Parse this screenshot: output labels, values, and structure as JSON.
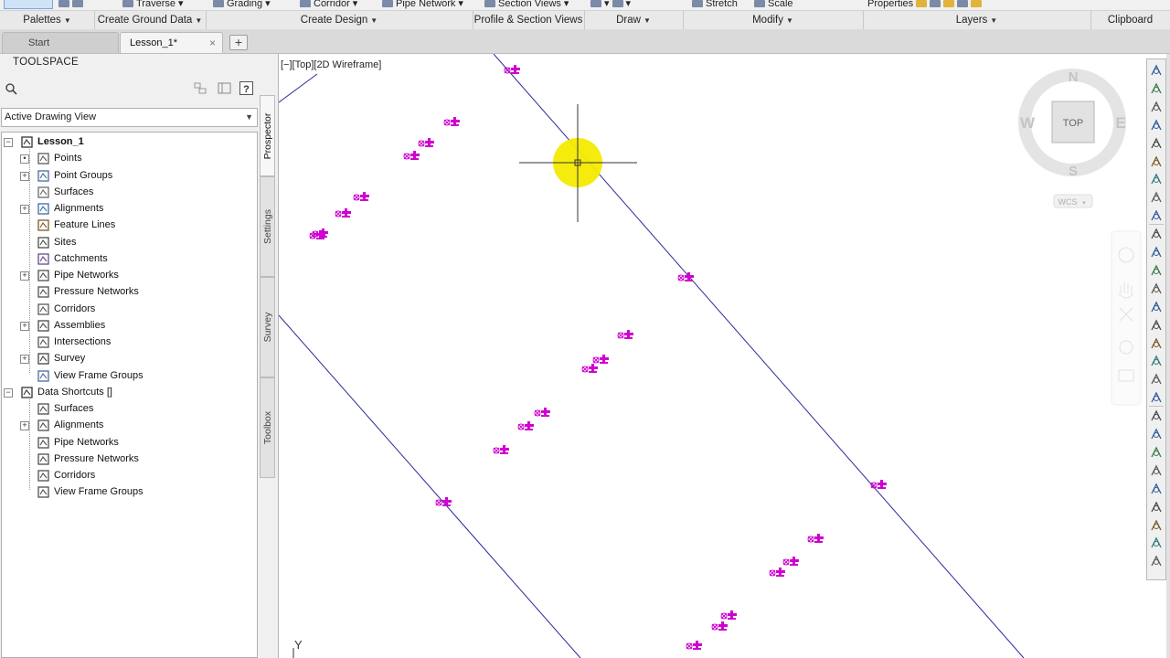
{
  "ribbon": {
    "top_tools": [
      "Traverse",
      "Grading",
      "Corridor",
      "Pipe Network",
      "Section Views",
      "Stretch",
      "Scale",
      "Properties"
    ],
    "panels": [
      "Palettes",
      "Create Ground Data",
      "Create Design",
      "Profile & Section Views",
      "Draw",
      "Modify",
      "Layers",
      "Clipboard"
    ]
  },
  "tabs": [
    {
      "label": "Start"
    },
    {
      "label": "Lesson_1*",
      "close": "×"
    }
  ],
  "new_tab_symbol": "+",
  "toolspace": {
    "title": "TOOLSPACE",
    "dropdown_value": "Active Drawing View",
    "side_tabs": [
      "Prospector",
      "Settings",
      "Survey",
      "Toolbox"
    ],
    "tree": {
      "drawing": "Lesson_1",
      "drawing_items": [
        "Points",
        "Point Groups",
        "Surfaces",
        "Alignments",
        "Feature Lines",
        "Sites",
        "Catchments",
        "Pipe Networks",
        "Pressure Networks",
        "Corridors",
        "Assemblies",
        "Intersections",
        "Survey",
        "View Frame Groups"
      ],
      "shortcuts": "Data Shortcuts []",
      "shortcut_items": [
        "Surfaces",
        "Alignments",
        "Pipe Networks",
        "Pressure Networks",
        "Corridors",
        "View Frame Groups"
      ]
    }
  },
  "viewport": {
    "label": "[−][Top][2D Wireframe]",
    "viewcube": {
      "north": "N",
      "south": "S",
      "east": "E",
      "west": "W",
      "face": "TOP",
      "ucs": "WCS"
    },
    "ucs_axis": "Y",
    "colors": {
      "points": "#d000d0",
      "lines": "#2a2a9a",
      "highlight": "#f4ea00"
    }
  }
}
